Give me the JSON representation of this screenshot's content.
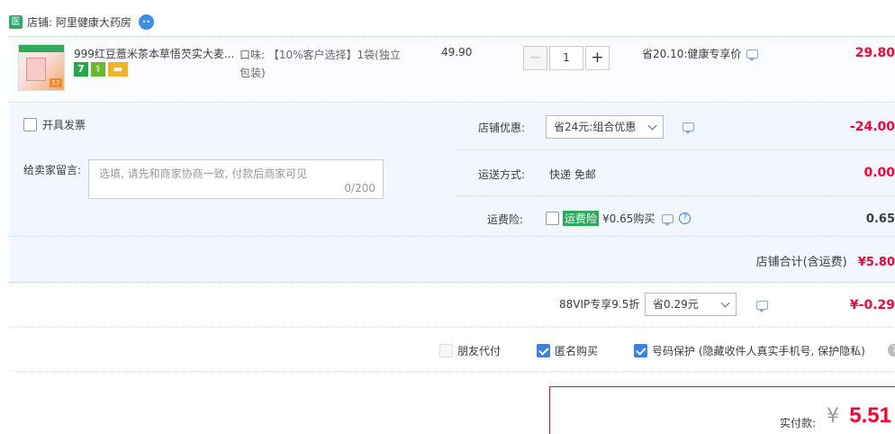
{
  "shop": {
    "badge": "医",
    "label": "店铺: 阿里健康大药房"
  },
  "item": {
    "title": "999红豆薏米茶本草悟芡实大麦...",
    "sku": "口味: 【10%客户选择】1袋(独立包装)",
    "unit_price": "49.90",
    "qty": "1",
    "qty_minus": "−",
    "qty_plus": "+",
    "save_note": "省20.10:健康专享价",
    "total": "29.80",
    "thumb_tag": "17",
    "svc_icons": [
      "seven-day-return-icon",
      "medicine-icon",
      "card-icon"
    ]
  },
  "options": {
    "invoice_label": "开具发票",
    "memo_label": "给卖家留言:",
    "memo_placeholder": "选填, 请先和商家协商一致, 付款后商家可见",
    "memo_count": "0/200",
    "discount": {
      "label": "店铺优惠:",
      "selected": "省24元:组合优惠",
      "amount": "-24.00"
    },
    "shipping": {
      "label": "运送方式:",
      "value": "快递 免邮",
      "amount": "0.00"
    },
    "insurance": {
      "label": "运费险:",
      "tag": "运费险",
      "text": "¥0.65购买",
      "amount": "0.65"
    },
    "store_total": {
      "label": "店铺合计(含运费)",
      "amount": "¥5.80"
    }
  },
  "vip": {
    "label": "88VIP专享9.5折",
    "selected": "省0.29元",
    "amount": "¥-0.29"
  },
  "privacy": {
    "friend_pay": "朋友代付",
    "anonymous": "匿名购买",
    "number_protect": "号码保护 (隐藏收件人真实手机号, 保护隐私)",
    "help": "?"
  },
  "pay": {
    "label": "实付款:",
    "currency": "¥",
    "amount": "5.51"
  },
  "colors": {
    "price_red": "#ff0036",
    "checkbox_blue": "#3f7fe0",
    "panel_bg": "#f2f7ff"
  }
}
